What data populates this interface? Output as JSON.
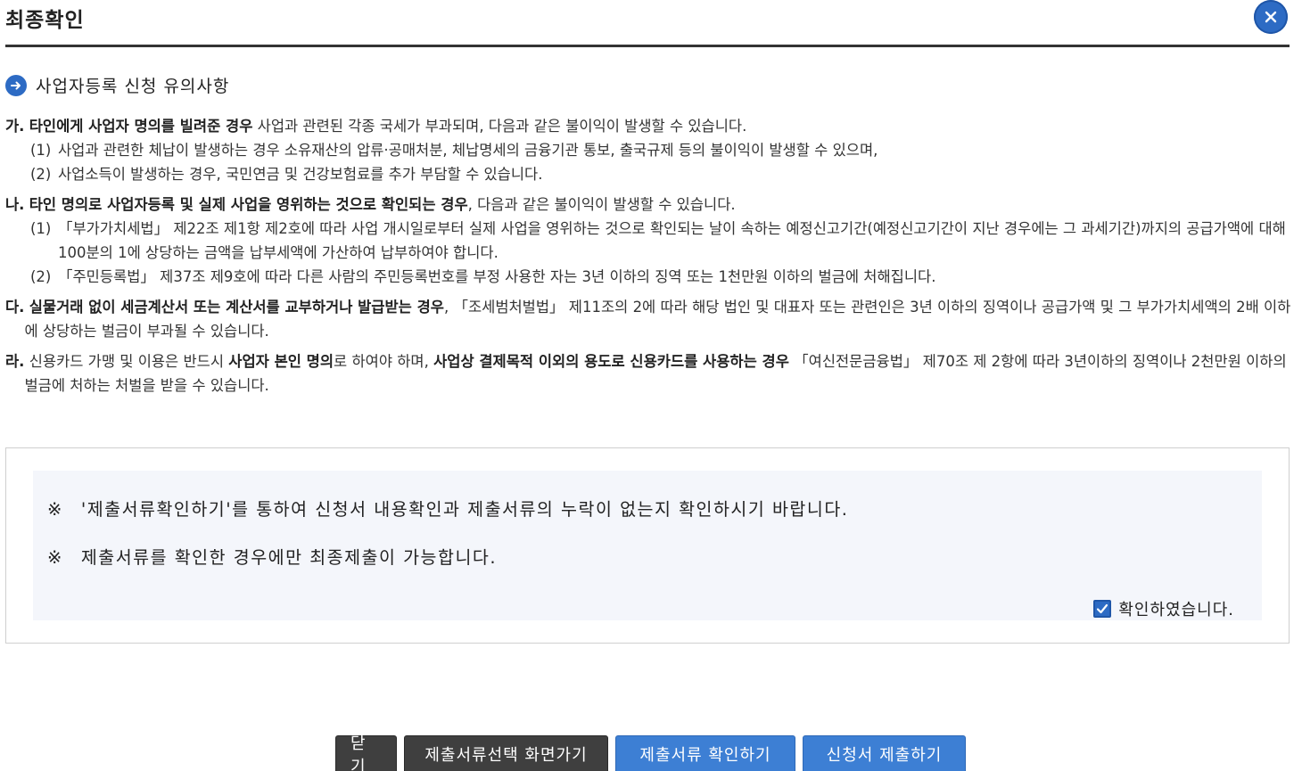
{
  "header": {
    "title": "최종확인",
    "close_icon": "close-icon"
  },
  "section": {
    "title": "사업자등록 신청 유의사항",
    "icon": "arrow-right-icon"
  },
  "notices": [
    {
      "mark": "가.",
      "bold": "타인에게 사업자 명의를 빌려준 경우",
      "text": " 사업과 관련된 각종 국세가 부과되며, 다음과 같은 불이익이 발생할 수 있습니다.",
      "subs": [
        {
          "num": "(1)",
          "text": "사업과 관련한 체납이 발생하는 경우 소유재산의 압류·공매처분, 체납명세의 금융기관 통보, 출국규제 등의 불이익이 발생할 수 있으며,"
        },
        {
          "num": "(2)",
          "text": "사업소득이 발생하는 경우, 국민연금 및 건강보험료를 추가 부담할 수 있습니다."
        }
      ]
    },
    {
      "mark": "나.",
      "bold": "타인 명의로 사업자등록 및 실제 사업을 영위하는 것으로 확인되는 경우",
      "text": ", 다음과 같은 불이익이 발생할 수 있습니다.",
      "subs": [
        {
          "num": "(1)",
          "text": "「부가가치세법」 제22조 제1항 제2호에 따라 사업 개시일로부터 실제 사업을 영위하는 것으로 확인되는 날이 속하는 예정신고기간(예정신고기간이 지난 경우에는 그 과세기간)까지의 공급가액에 대해 100분의 1에 상당하는 금액을 납부세액에 가산하여 납부하여야 합니다."
        },
        {
          "num": "(2)",
          "text": "「주민등록법」 제37조 제9호에 따라 다른 사람의 주민등록번호를 부정 사용한 자는 3년 이하의 징역 또는 1천만원 이하의 벌금에 처해집니다."
        }
      ]
    },
    {
      "mark": "다.",
      "bold": "실물거래 없이 세금계산서 또는 계산서를 교부하거나 발급받는 경우",
      "text": ", 「조세범처벌법」 제11조의 2에 따라 해당 법인 및 대표자 또는 관련인은 3년 이하의 징역이나 공급가액 및 그 부가가치세액의 2배 이하에 상당하는 벌금이 부과될 수 있습니다.",
      "subs": []
    },
    {
      "mark": "라.",
      "text1": "신용카드 가맹 및 이용은 반드시 ",
      "bold1": "사업자 본인 명의",
      "text2": "로 하여야 하며, ",
      "bold2": "사업상 결제목적 이외의 용도로 신용카드를 사용하는 경우",
      "text3": " 「여신전문금융법」 제70조 제 2항에 따라 3년이하의 징역이나 2천만원 이하의 벌금에 처하는 처벌을 받을 수 있습니다."
    }
  ],
  "confirm": {
    "ref_mark": "※",
    "line1": "'제출서류확인하기'를 통하여 신청서 내용확인과 제출서류의 누락이 없는지 확인하시기 바랍니다.",
    "line2": "제출서류를 확인한 경우에만 최종제출이 가능합니다.",
    "checkbox_label": "확인하였습니다.",
    "checked": true
  },
  "buttons": {
    "close": "닫기",
    "select_docs": "제출서류선택 화면가기",
    "check_docs": "제출서류 확인하기",
    "submit": "신청서 제출하기"
  },
  "colors": {
    "accent": "#2d6bc4",
    "button_dark": "#3f3f3f",
    "button_blue": "#3d7fd4"
  }
}
